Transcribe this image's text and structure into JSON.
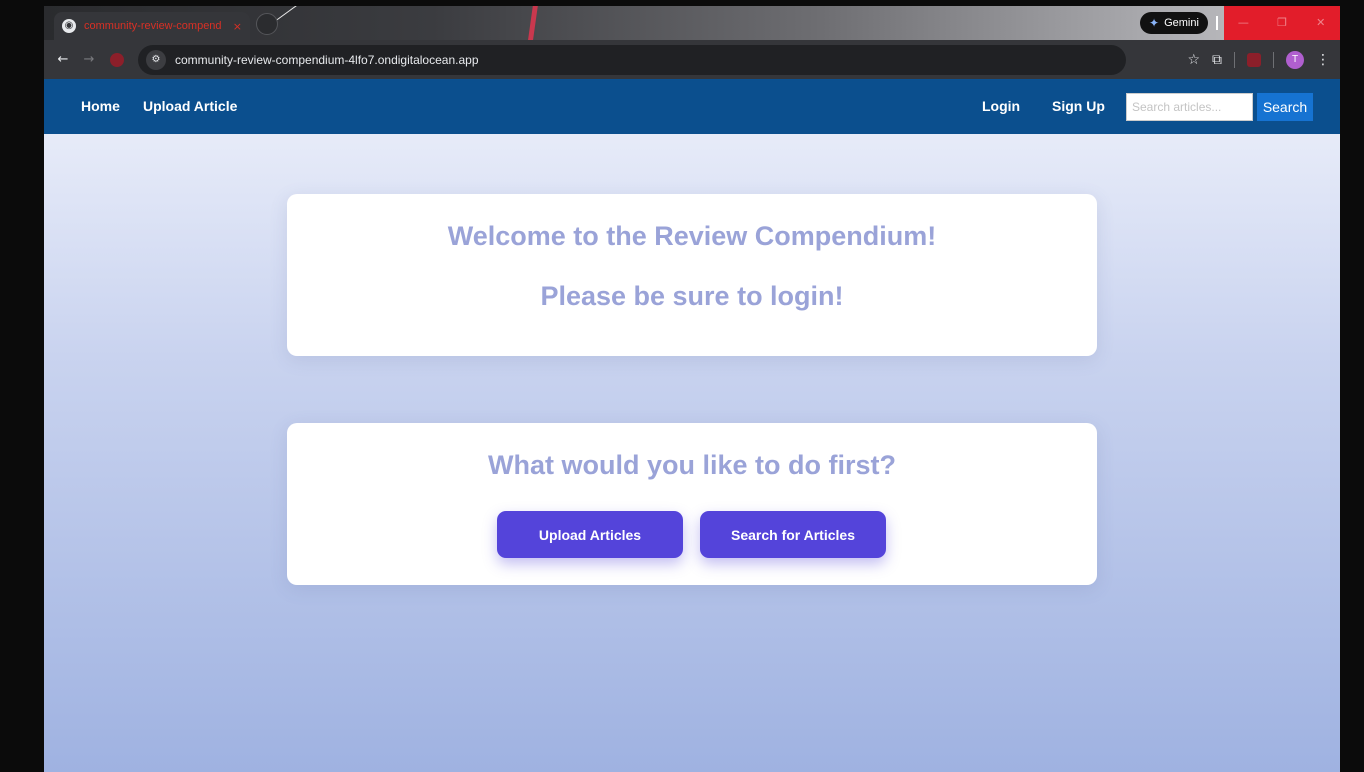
{
  "browser": {
    "tab_title": "community-review-compend",
    "tab_close": "×",
    "favicon_glyph": "◉",
    "gemini_label": "Gemini",
    "gemini_glyph": "✦",
    "window_controls": [
      "—",
      "❐",
      "✕"
    ],
    "back_glyph": "←",
    "forward_glyph": "→",
    "site_info_glyph": "⚙",
    "url": "community-review-compendium-4lfo7.ondigitalocean.app",
    "bookmark_glyph": "☆",
    "extensions_glyph": "⧉",
    "profile_initial": "T",
    "menu_glyph": "⋮"
  },
  "nav": {
    "home": "Home",
    "upload_article": "Upload Article",
    "login": "Login",
    "sign_up": "Sign Up",
    "search_placeholder": "Search articles...",
    "search_button": "Search"
  },
  "welcome": {
    "heading": "Welcome to the Review Compendium!",
    "subheading": "Please be sure to login!"
  },
  "actions": {
    "heading": "What would you like to do first?",
    "upload_button": "Upload Articles",
    "search_button": "Search for Articles"
  },
  "colors": {
    "navbar": "#0b4f8e",
    "cta": "#5444da",
    "heading": "#9aa3d8",
    "search_button": "#1673d2"
  }
}
